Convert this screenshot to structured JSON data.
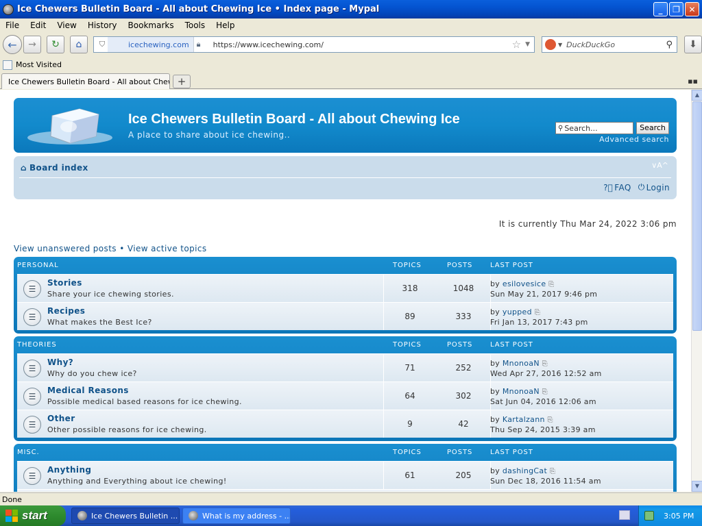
{
  "window": {
    "title": "Ice Chewers Bulletin Board - All about Chewing Ice • Index page - Mypal",
    "minimize_icon": "minimize-icon",
    "maximize_icon": "maximize-icon",
    "close_icon": "close-icon"
  },
  "menu": [
    "File",
    "Edit",
    "View",
    "History",
    "Bookmarks",
    "Tools",
    "Help"
  ],
  "navbar": {
    "site_identity": "icechewing.com",
    "url": "https://www.icechewing.com/",
    "search_placeholder": "DuckDuckGo"
  },
  "bookmarks": {
    "most_visited": "Most Visited"
  },
  "tab": {
    "label": "Ice Chewers Bulletin Board - All about Chewi..."
  },
  "header": {
    "title": "Ice Chewers Bulletin Board - All about Chewing Ice",
    "description": "A place to share about ice chewing..",
    "search_placeholder": "Search...",
    "search_button": "Search",
    "advanced_search": "Advanced search"
  },
  "navband": {
    "board_index": "Board index",
    "font_resize": "∨A^",
    "faq": "FAQ",
    "login": "Login"
  },
  "current_time": "It is currently Thu Mar 24, 2022 3:06 pm",
  "quicklinks": {
    "unanswered": "View unanswered posts",
    "bullet": "•",
    "active": "View active topics"
  },
  "columns": {
    "topics": "TOPICS",
    "posts": "POSTS",
    "last_post": "LAST POST"
  },
  "categories": [
    {
      "name": "PERSONAL",
      "forums": [
        {
          "name": "Stories",
          "desc": "Share your ice chewing stories.",
          "topics": "318",
          "posts": "1048",
          "by": "by",
          "user": "esilovesice",
          "date": "Sun May 21, 2017 9:46 pm"
        },
        {
          "name": "Recipes",
          "desc": "What makes the Best Ice?",
          "topics": "89",
          "posts": "333",
          "by": "by",
          "user": "yupped",
          "date": "Fri Jan 13, 2017 7:43 pm"
        }
      ]
    },
    {
      "name": "THEORIES",
      "forums": [
        {
          "name": "Why?",
          "desc": "Why do you chew ice?",
          "topics": "71",
          "posts": "252",
          "by": "by",
          "user": "MnonoaN",
          "date": "Wed Apr 27, 2016 12:52 am"
        },
        {
          "name": "Medical Reasons",
          "desc": "Possible medical based reasons for ice chewing.",
          "topics": "64",
          "posts": "302",
          "by": "by",
          "user": "MnonoaN",
          "date": "Sat Jun 04, 2016 12:06 am"
        },
        {
          "name": "Other",
          "desc": "Other possible reasons for ice chewing.",
          "topics": "9",
          "posts": "42",
          "by": "by",
          "user": "Kartalzann",
          "date": "Thu Sep 24, 2015 3:39 am"
        }
      ]
    },
    {
      "name": "MISC.",
      "forums": [
        {
          "name": "Anything",
          "desc": "Anything and Everything about ice chewing!",
          "topics": "61",
          "posts": "205",
          "by": "by",
          "user": "dashingCat",
          "date": "Sun Dec 18, 2016 11:54 am"
        }
      ]
    }
  ],
  "status": "Done",
  "taskbar": {
    "start": "start",
    "tasks": [
      "Ice Chewers Bulletin ...",
      "What is my address - ..."
    ],
    "clock": "3:05 PM"
  }
}
